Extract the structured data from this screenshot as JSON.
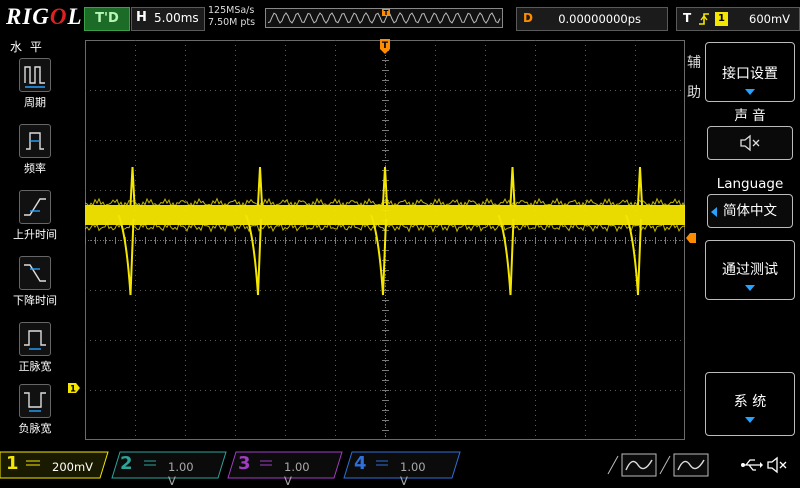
{
  "header": {
    "logo": "RIGOL",
    "run_state": "T'D",
    "horizontal_label": "H",
    "timebase": "5.00ms",
    "sample_rate": "125MSa/s",
    "memory_depth": "7.50M pts",
    "delay_label": "D",
    "delay_value": "0.00000000ps",
    "trigger_label": "T",
    "trigger_source": "1",
    "trigger_level": "600mV"
  },
  "left_menu": {
    "title": "水 平",
    "items": [
      {
        "label": "周期",
        "icon": "period-icon"
      },
      {
        "label": "频率",
        "icon": "frequency-icon"
      },
      {
        "label": "上升时间",
        "icon": "rise-time-icon"
      },
      {
        "label": "下降时间",
        "icon": "fall-time-icon"
      },
      {
        "label": "正脉宽",
        "icon": "positive-width-icon"
      },
      {
        "label": "负脉宽",
        "icon": "negative-width-icon"
      }
    ]
  },
  "right_menu": {
    "aux_title": "辅助",
    "interface_label": "接口设置",
    "sound_label": "声 音",
    "sound_value_icon": "speaker-mute-icon",
    "language_label": "Language",
    "language_value": "简体中文",
    "pass_fail_label": "通过测试",
    "system_label": "系 统"
  },
  "markers": {
    "trigger_position": "T",
    "channel1": "1"
  },
  "channels": [
    {
      "number": "1",
      "value": "200mV",
      "color": "#f5e600",
      "active": true
    },
    {
      "number": "2",
      "value": "1.00 V",
      "color": "#2fa39a",
      "active": false
    },
    {
      "number": "3",
      "value": "1.00 V",
      "color": "#a23cc4",
      "active": false
    },
    {
      "number": "4",
      "value": "1.00 V",
      "color": "#2f6fd8",
      "active": false
    }
  ],
  "trace": {
    "color": "#f5e600",
    "baseline_div": 0.5,
    "spike_depth_div": 1.6,
    "spike_times_div": [
      0.95,
      3.5,
      6.0,
      8.55,
      11.1
    ]
  },
  "colors": {
    "accent": "#27a3ff",
    "trigger": "#ff8c00",
    "run_state": "#1c6b27"
  }
}
